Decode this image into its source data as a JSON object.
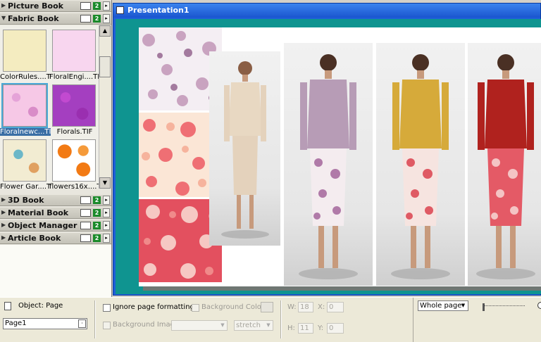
{
  "left_panel": {
    "books_top": [
      {
        "label": "Picture Book",
        "expanded": false,
        "icon": "picture-icon"
      },
      {
        "label": "Fabric Book",
        "expanded": true,
        "icon": "fabric-icon"
      }
    ],
    "thumbnails": [
      {
        "caption": "ColorRules....TIF",
        "selected": false
      },
      {
        "caption": "FloralEngi....TIF",
        "selected": false
      },
      {
        "caption": "Floralnewc...TIF",
        "selected": true
      },
      {
        "caption": "Florals.TIF",
        "selected": false
      },
      {
        "caption": "Flower Gar....TIF",
        "selected": false
      },
      {
        "caption": "flowers16x....TIF",
        "selected": false
      }
    ],
    "books_bottom": [
      {
        "label": "3D Book",
        "expanded": false,
        "icon": "3d-icon"
      },
      {
        "label": "Material Book",
        "expanded": false,
        "icon": "material-icon"
      },
      {
        "label": "Object Manager",
        "expanded": false,
        "icon": "object-icon"
      },
      {
        "label": "Article Book",
        "expanded": false,
        "icon": "article-icon"
      }
    ]
  },
  "document": {
    "title": "Presentation1"
  },
  "status_bar": {
    "object_label": "Object: Page",
    "page_name": "Page1",
    "ignore_formatting_label": "Ignore page formatting",
    "background_color_label": "Background Color:",
    "background_image_label": "Background Image:",
    "stretch_value": "stretch",
    "w_label": "W:",
    "w_value": "18",
    "h_label": "H:",
    "h_value": "11",
    "x_label": "X:",
    "x_value": "0",
    "y_label": "Y:",
    "y_value": "0",
    "zoom_value": "Whole page"
  },
  "colors": {
    "title_bar": "#1a55cf",
    "canvas_teal": "#0f9490",
    "selection_blue": "#3a6ea5"
  }
}
